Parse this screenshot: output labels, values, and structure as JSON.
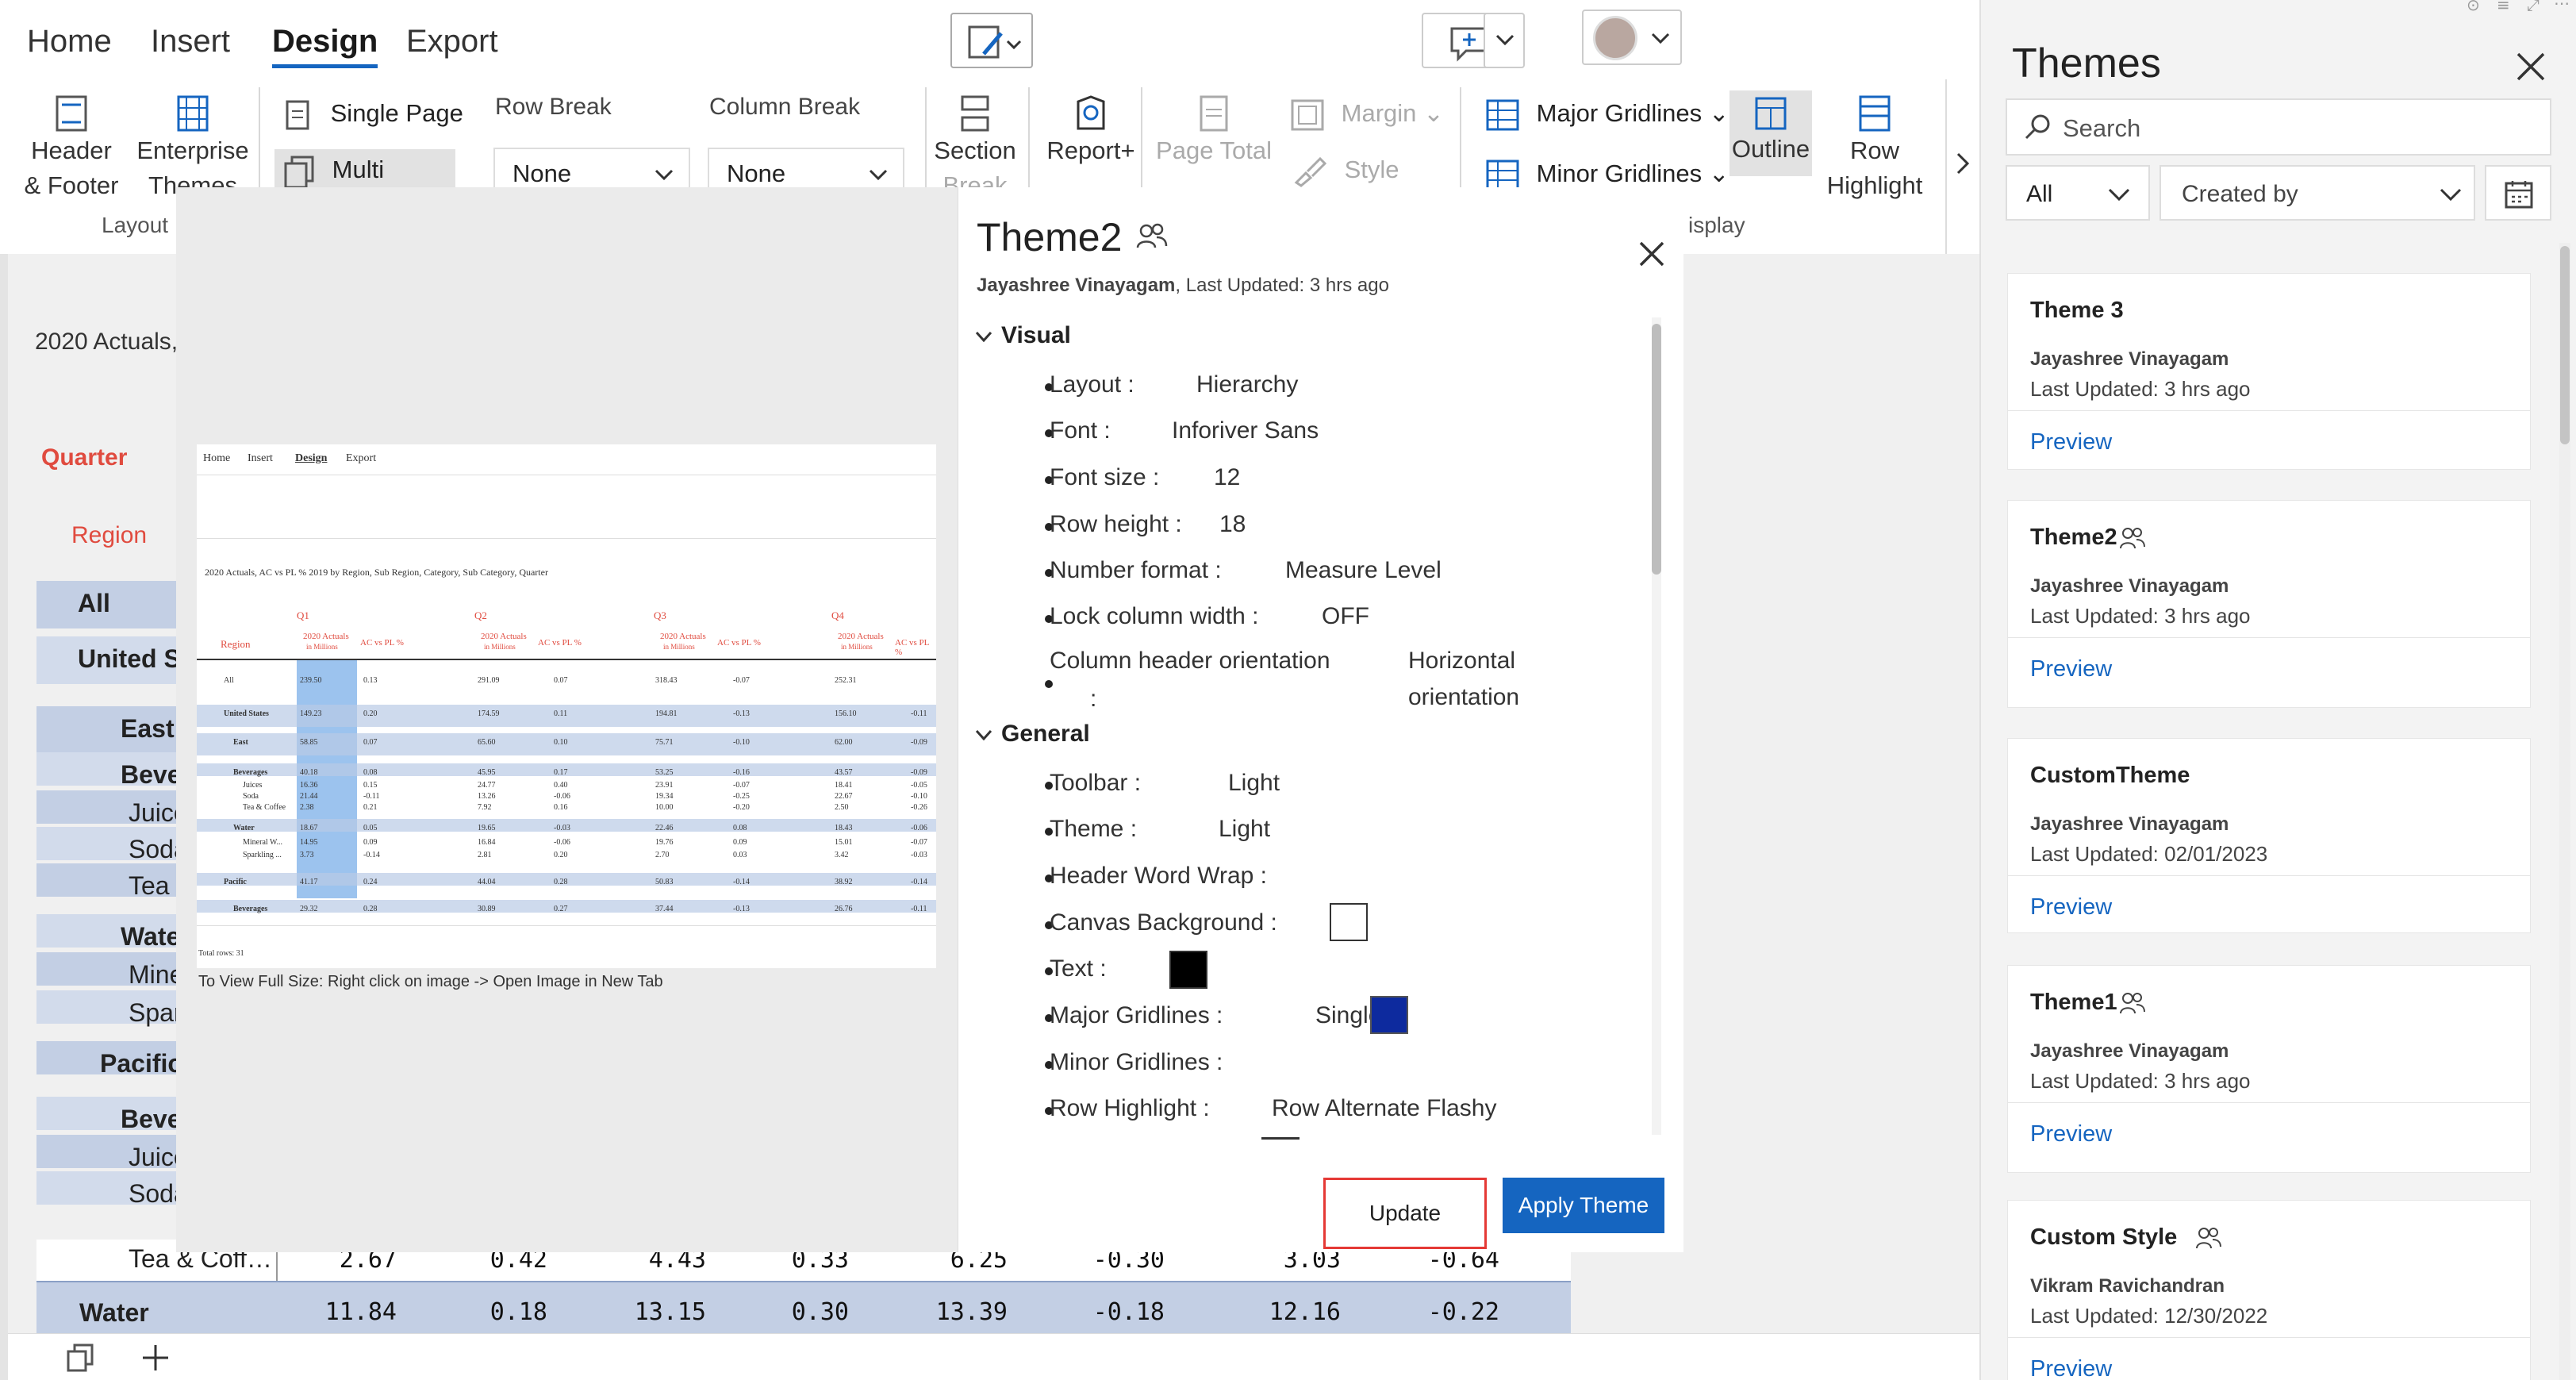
{
  "tabs": [
    "Home",
    "Insert",
    "Design",
    "Export"
  ],
  "ribbon": {
    "header_footer": [
      "Header",
      "& Footer"
    ],
    "enterprise_themes": [
      "Enterprise",
      "Themes"
    ],
    "single_page": "Single Page",
    "multi_pages": "Multi Pages",
    "row_break": "Row Break",
    "row_break_value": "None",
    "column_break": "Column Break",
    "column_break_value": "None",
    "section_break": [
      "Section",
      "Break"
    ],
    "report_plus": "Report+",
    "page_total": "Page Total",
    "margin": "Margin",
    "style": "Style",
    "major_gridlines": "Major Gridlines",
    "minor_gridlines": "Minor Gridlines",
    "outline": "Outline",
    "row_highlight": [
      "Row",
      "Highlight"
    ],
    "groups": {
      "layout": "Layout",
      "display": "isplay"
    }
  },
  "report": {
    "title": "2020 Actuals,",
    "quarter_label": "Quarter",
    "region_label": "Region",
    "rows": [
      "All",
      "United St",
      "East",
      "Bever",
      "Juice",
      "Soda",
      "Tea &",
      "Wate",
      "Mine",
      "Spar",
      "Pacific",
      "Bever",
      "Juice",
      "Soda"
    ],
    "tea_row": {
      "label": "Tea & Coff…",
      "values": [
        "2.67",
        "0.42",
        "4.43",
        "0.33",
        "6.25",
        "-0.30",
        "3.03",
        "-0.64"
      ]
    },
    "water_row": {
      "label": "Water",
      "values": [
        "11.84",
        "0.18",
        "13.15",
        "0.30",
        "13.39",
        "-0.18",
        "12.16",
        "-0.22"
      ]
    }
  },
  "modal": {
    "title": "Theme2",
    "author": "Jayashree Vinayagam",
    "last_updated": ", Last Updated: 3 hrs ago",
    "hint": "To View Full Size: Right click on image -> Open Image in New Tab",
    "visual_section": "Visual",
    "general_section": "General",
    "visual": [
      {
        "label": "Layout :",
        "value": "Hierarchy"
      },
      {
        "label": "Font :",
        "value": "Inforiver Sans"
      },
      {
        "label": "Font size :",
        "value": "12"
      },
      {
        "label": "Row height :",
        "value": "18"
      },
      {
        "label": "Number format :",
        "value": "Measure Level"
      },
      {
        "label": "Lock column width :",
        "value": "OFF"
      }
    ],
    "col_header_orientation": {
      "label1": "Column header orientation",
      "label2": ":",
      "value1": "Horizontal",
      "value2": "orientation"
    },
    "general": [
      {
        "label": "Toolbar :",
        "value": "Light"
      },
      {
        "label": "Theme :",
        "value": "Light"
      },
      {
        "label": "Header Word Wrap :",
        "value": ""
      },
      {
        "label": "Canvas Background :",
        "value": ""
      },
      {
        "label": "Text :",
        "value": ""
      },
      {
        "label": "Major Gridlines :",
        "value": "Single"
      },
      {
        "label": "Minor Gridlines :",
        "value": ""
      },
      {
        "label": "Row Highlight :",
        "value": "Row Alternate Flashy"
      }
    ],
    "swatches": {
      "canvas": "#ffffff",
      "text": "#000000",
      "major": "#0d2a9e"
    },
    "update_label": "Update",
    "apply_label": "Apply Theme"
  },
  "preview": {
    "tabs": [
      "Home",
      "Insert",
      "Design",
      "Export"
    ],
    "subtitle": "2020 Actuals, AC vs PL % 2019 by Region, Sub Region, Category, Sub Category, Quarter",
    "quarters": [
      "Q1",
      "Q2",
      "Q3",
      "Q4"
    ],
    "region": "Region",
    "col_a": "2020 Actuals",
    "col_a_sub": "in Millions",
    "col_b": "AC vs PL %",
    "rows": [
      {
        "label": "All",
        "v": [
          "239.50",
          "0.13",
          "291.09",
          "0.07",
          "318.43",
          "-0.07",
          "252.31",
          ""
        ]
      },
      {
        "label": "United States",
        "v": [
          "149.23",
          "0.20",
          "174.59",
          "0.11",
          "194.81",
          "-0.13",
          "156.10",
          "-0.11"
        ]
      },
      {
        "label": "East",
        "v": [
          "58.85",
          "0.07",
          "65.60",
          "0.10",
          "75.71",
          "-0.10",
          "62.00",
          "-0.09"
        ]
      },
      {
        "label": "Beverages",
        "v": [
          "40.18",
          "0.08",
          "45.95",
          "0.17",
          "53.25",
          "-0.16",
          "43.57",
          "-0.09"
        ]
      },
      {
        "label": "Juices",
        "v": [
          "16.36",
          "0.15",
          "24.77",
          "0.40",
          "23.91",
          "-0.07",
          "18.41",
          "-0.05"
        ]
      },
      {
        "label": "Soda",
        "v": [
          "21.44",
          "-0.11",
          "13.26",
          "-0.06",
          "19.34",
          "-0.25",
          "22.67",
          "-0.10"
        ]
      },
      {
        "label": "Tea & Coffee",
        "v": [
          "2.38",
          "0.21",
          "7.92",
          "0.16",
          "10.00",
          "-0.20",
          "2.50",
          "-0.26"
        ]
      },
      {
        "label": "Water",
        "v": [
          "18.67",
          "0.05",
          "19.65",
          "-0.03",
          "22.46",
          "0.08",
          "18.43",
          "-0.06"
        ]
      },
      {
        "label": "Mineral W...",
        "v": [
          "14.95",
          "0.09",
          "16.84",
          "-0.06",
          "19.76",
          "0.09",
          "15.01",
          "-0.07"
        ]
      },
      {
        "label": "Sparkling ...",
        "v": [
          "3.73",
          "-0.14",
          "2.81",
          "0.20",
          "2.70",
          "0.03",
          "3.42",
          "-0.03"
        ]
      },
      {
        "label": "Pacific",
        "v": [
          "41.17",
          "0.24",
          "44.04",
          "0.28",
          "50.83",
          "-0.14",
          "38.92",
          "-0.14"
        ]
      },
      {
        "label": "Beverages",
        "v": [
          "29.32",
          "0.28",
          "30.89",
          "0.27",
          "37.44",
          "-0.13",
          "26.76",
          "-0.11"
        ]
      }
    ],
    "footer": "Total rows: 31"
  },
  "themes_panel": {
    "title": "Themes",
    "search_placeholder": "Search",
    "filter_all": "All",
    "filter_created_by": "Created by",
    "cards": [
      {
        "name": "Theme 3",
        "author": "Jayashree Vinayagam",
        "updated": "Last Updated: 3 hrs ago",
        "preview": "Preview",
        "shared": false
      },
      {
        "name": "Theme2",
        "author": "Jayashree Vinayagam",
        "updated": "Last Updated: 3 hrs ago",
        "preview": "Preview",
        "shared": true
      },
      {
        "name": "CustomTheme",
        "author": "Jayashree Vinayagam",
        "updated": "Last Updated: 02/01/2023",
        "preview": "Preview",
        "shared": false
      },
      {
        "name": "Theme1",
        "author": "Jayashree Vinayagam",
        "updated": "Last Updated: 3 hrs ago",
        "preview": "Preview",
        "shared": true
      },
      {
        "name": "Custom Style",
        "author": "Vikram Ravichandran",
        "updated": "Last Updated: 12/30/2022",
        "preview": "Preview",
        "shared": true
      }
    ]
  }
}
